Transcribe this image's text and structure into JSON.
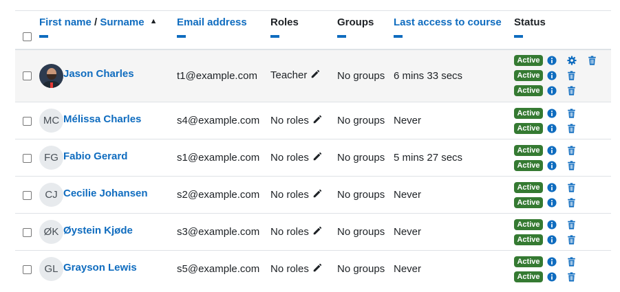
{
  "header": {
    "first_name": "First name",
    "separator": " / ",
    "surname": "Surname",
    "email": "Email address",
    "roles": "Roles",
    "groups": "Groups",
    "last_access": "Last access to course",
    "status": "Status"
  },
  "colors": {
    "link": "#0f6cbf",
    "active_badge": "#357a32",
    "row_highlight": "#f5f5f5"
  },
  "users": [
    {
      "initials": "",
      "name": "Jason Charles",
      "email": "t1@example.com",
      "role": "Teacher",
      "groups": "No groups",
      "last_access": "6 mins 33 secs",
      "statuses": [
        "Active",
        "Active",
        "Active"
      ]
    },
    {
      "initials": "MC",
      "name": "Mélissa Charles",
      "email": "s4@example.com",
      "role": "No roles",
      "groups": "No groups",
      "last_access": "Never",
      "statuses": [
        "Active",
        "Active"
      ]
    },
    {
      "initials": "FG",
      "name": "Fabio Gerard",
      "email": "s1@example.com",
      "role": "No roles",
      "groups": "No groups",
      "last_access": "5 mins 27 secs",
      "statuses": [
        "Active",
        "Active"
      ]
    },
    {
      "initials": "CJ",
      "name": "Cecilie Johansen",
      "email": "s2@example.com",
      "role": "No roles",
      "groups": "No groups",
      "last_access": "Never",
      "statuses": [
        "Active",
        "Active"
      ]
    },
    {
      "initials": "ØK",
      "name": "Øystein Kjøde",
      "email": "s3@example.com",
      "role": "No roles",
      "groups": "No groups",
      "last_access": "Never",
      "statuses": [
        "Active",
        "Active"
      ]
    },
    {
      "initials": "GL",
      "name": "Grayson Lewis",
      "email": "s5@example.com",
      "role": "No roles",
      "groups": "No groups",
      "last_access": "Never",
      "statuses": [
        "Active",
        "Active"
      ]
    }
  ]
}
